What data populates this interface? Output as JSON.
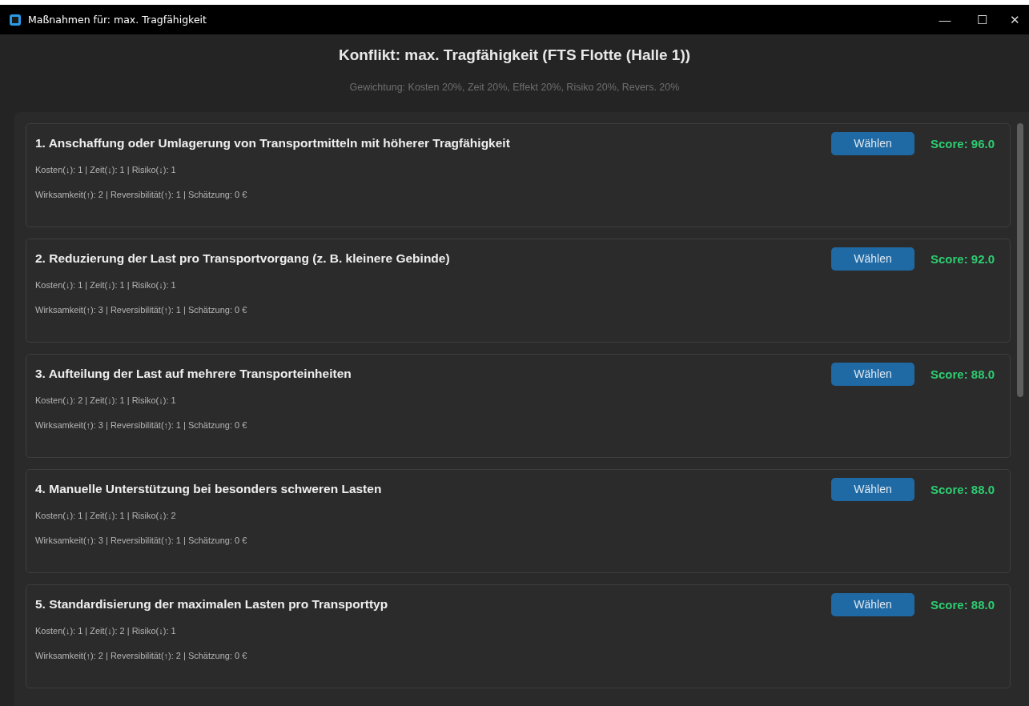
{
  "window": {
    "title": "Maßnahmen für: max. Tragfähigkeit",
    "controls": [
      "—",
      "☐",
      "✕"
    ]
  },
  "heading": "Konflikt: max. Tragfähigkeit (FTS Flotte (Halle 1))",
  "weighting": "Gewichtung: Kosten 20%, Zeit 20%, Effekt 20%, Risiko 20%, Revers. 20%",
  "measures": [
    {
      "title": "1. Anschaffung oder Umlagerung von Transportmitteln mit höherer Tragfähigkeit",
      "line_1": "Kosten(↓): 1 | Zeit(↓): 1 | Risiko(↓): 1",
      "line_2": "Wirksamkeit(↑): 2 | Reversibilität(↑): 1 | Schätzung: 0 €",
      "button": "Wählen",
      "score": "Score: 96.0"
    },
    {
      "title": "2. Reduzierung der Last pro Transportvorgang (z. B. kleinere Gebinde)",
      "line_1": "Kosten(↓): 1 | Zeit(↓): 1 | Risiko(↓): 1",
      "line_2": "Wirksamkeit(↑): 3 | Reversibilität(↑): 1 | Schätzung: 0 €",
      "button": "Wählen",
      "score": "Score: 92.0"
    },
    {
      "title": "3. Aufteilung der Last auf mehrere Transporteinheiten",
      "line_1": "Kosten(↓): 2 | Zeit(↓): 1 | Risiko(↓): 1",
      "line_2": "Wirksamkeit(↑): 3 | Reversibilität(↑): 1 | Schätzung: 0 €",
      "button": "Wählen",
      "score": "Score: 88.0"
    },
    {
      "title": "4. Manuelle Unterstützung bei besonders schweren Lasten",
      "line_1": "Kosten(↓): 1 | Zeit(↓): 1 | Risiko(↓): 2",
      "line_2": "Wirksamkeit(↑): 3 | Reversibilität(↑): 1 | Schätzung: 0 €",
      "button": "Wählen",
      "score": "Score: 88.0"
    },
    {
      "title": "5. Standardisierung der maximalen Lasten pro Transporttyp",
      "line_1": "Kosten(↓): 1 | Zeit(↓): 2 | Risiko(↓): 1",
      "line_2": "Wirksamkeit(↑): 2 | Reversibilität(↑): 2 | Schätzung: 0 €",
      "button": "Wählen",
      "score": "Score: 88.0"
    }
  ]
}
